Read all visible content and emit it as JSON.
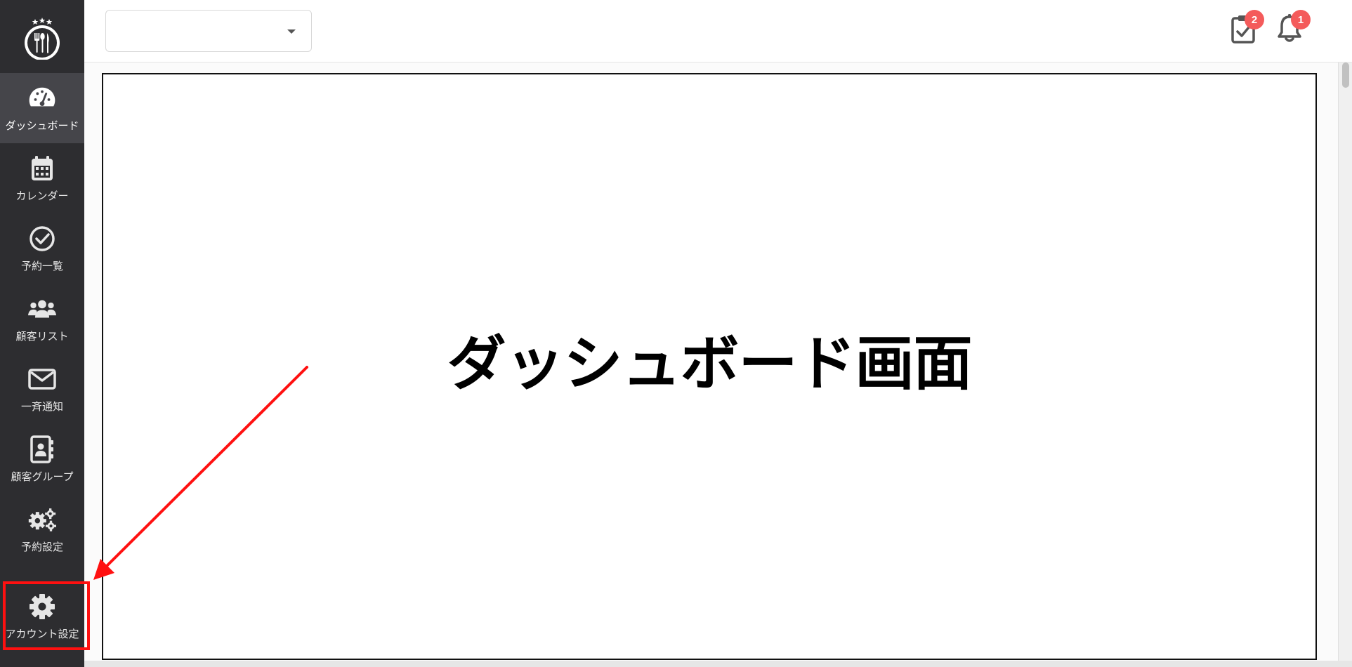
{
  "sidebar": {
    "items": [
      {
        "label": "ダッシュボード",
        "icon": "dashboard-gauge-icon",
        "active": true
      },
      {
        "label": "カレンダー",
        "icon": "calendar-icon"
      },
      {
        "label": "予約一覧",
        "icon": "check-circle-icon"
      },
      {
        "label": "顧客リスト",
        "icon": "users-icon"
      },
      {
        "label": "一斉通知",
        "icon": "envelope-icon"
      },
      {
        "label": "顧客グループ",
        "icon": "address-book-icon"
      },
      {
        "label": "予約設定",
        "icon": "gears-icon"
      },
      {
        "label": "アカウント設定",
        "icon": "gear-icon"
      }
    ]
  },
  "header": {
    "store_select": {
      "value": ""
    },
    "tasks_badge": "2",
    "notifications_badge": "1"
  },
  "main": {
    "title": "ダッシュボード画面"
  },
  "colors": {
    "sidebar_bg": "#2d2d30",
    "active_item_bg": "#45454a",
    "badge": "#f45b5b",
    "annotation": "#ff1010"
  }
}
